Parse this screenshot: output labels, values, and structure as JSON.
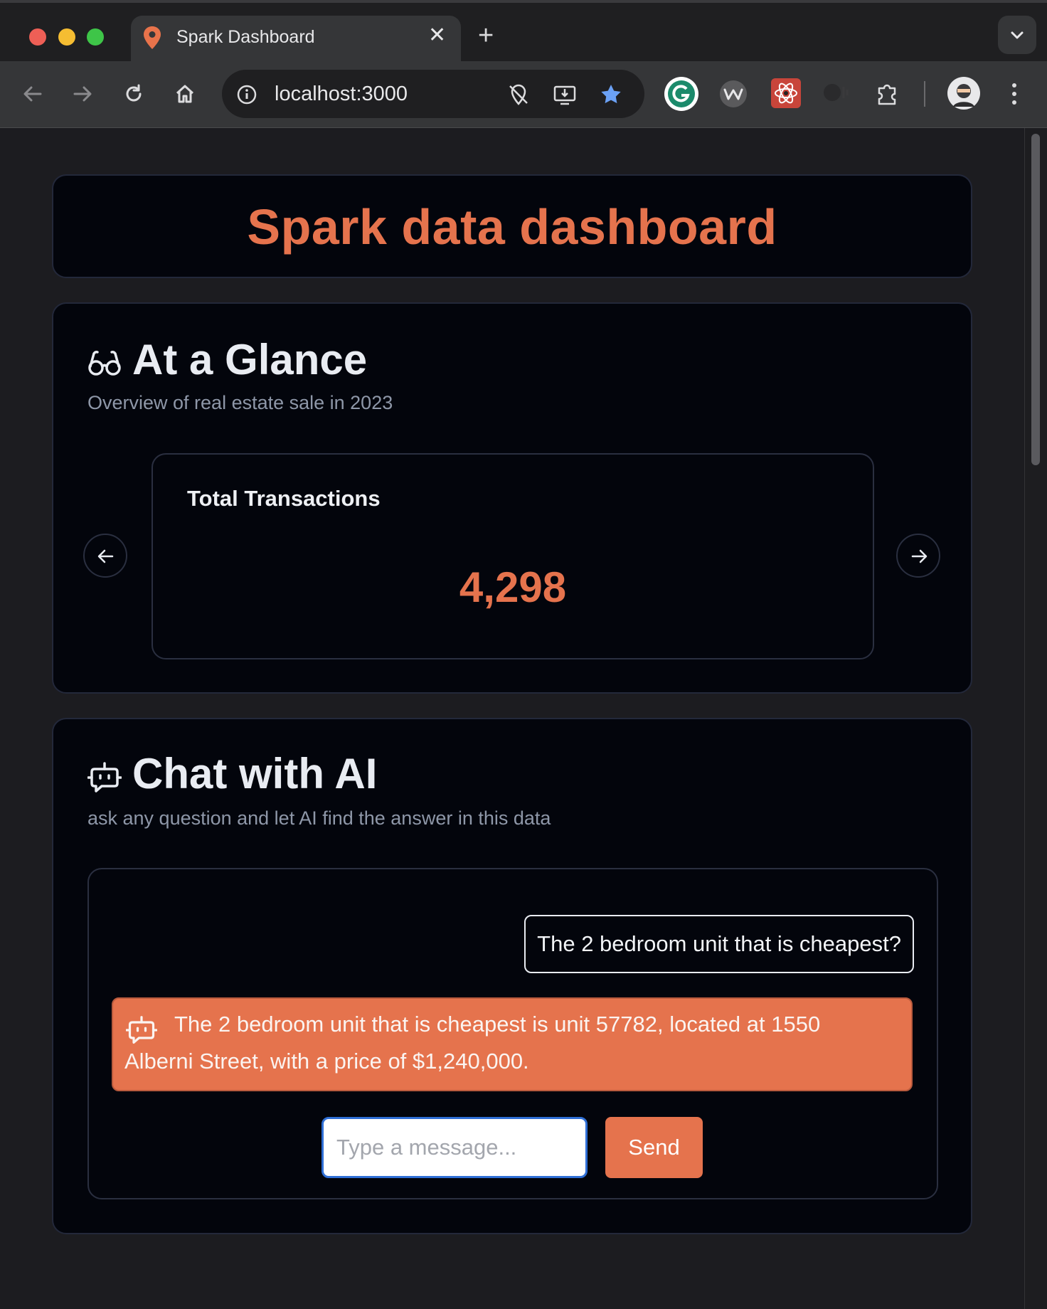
{
  "browser": {
    "tab_title": "Spark Dashboard",
    "tab_close": "✕",
    "new_tab": "+",
    "url": "localhost:3000"
  },
  "header": {
    "title": "Spark data dashboard"
  },
  "glance": {
    "title": "At a Glance",
    "subtitle": "Overview of real estate sale in 2023",
    "stat_label": "Total Transactions",
    "stat_value": "4,298"
  },
  "chat": {
    "title": "Chat with AI",
    "subtitle": "ask any question and let AI find the answer in this data",
    "user_message": "The 2 bedroom unit that is cheapest?",
    "ai_line1": "The 2 bedroom unit that is cheapest is unit 57782, located at 1550",
    "ai_line2": "Alberni Street, with a price of $1,240,000.",
    "input_placeholder": "Type a message...",
    "send_label": "Send"
  },
  "colors": {
    "accent": "#e5734d",
    "card_bg": "#03050c",
    "page_bg": "#1c1c20",
    "focus_ring": "#2f6fd6"
  }
}
